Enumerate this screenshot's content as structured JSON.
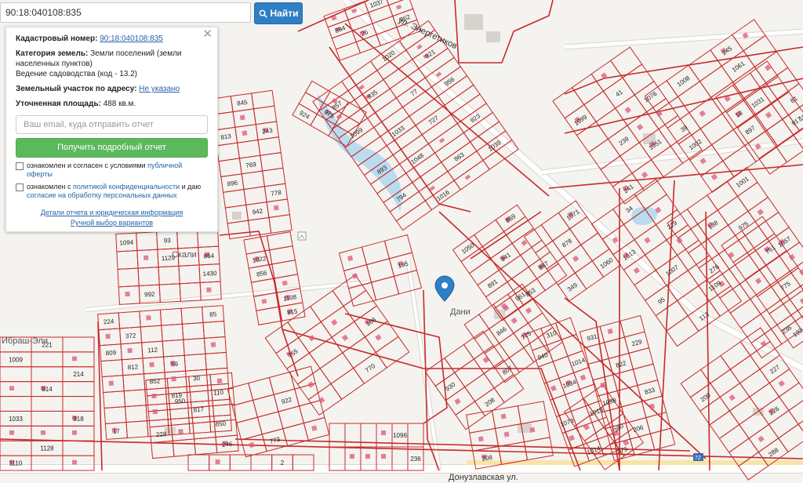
{
  "search": {
    "value": "90:18:040108:835",
    "button_label": "Найти"
  },
  "panel": {
    "cadastral_label": "Кадастровый номер:",
    "cadastral_value": "90:18:040108:835",
    "category_label": "Категория земель:",
    "category_value": "Земли поселений (земли населенных пунктов)",
    "usage_value": "Ведение садоводства (код - 13.2)",
    "address_label": "Земельный участок по адресу:",
    "address_value": "Не указано",
    "area_label": "Уточненная площадь:",
    "area_value": "488 кв.м.",
    "email_placeholder": "Ваш email, куда отправить отчет",
    "report_button": "Получить подробный отчет",
    "check1_text": "ознакомлен и согласен с условиями",
    "check1_link": "публичной оферты",
    "check2_text": "ознакомлен с",
    "check2_link": "политикой конфиденциальности",
    "check2_mid": "и даю",
    "check2_link2": "согласие на обработку персональных данных",
    "details_link": "Детали отчета и юридическая информация",
    "manual_link": "Ручной выбор вариантов"
  },
  "map": {
    "streets": {
      "energetikov": "ул. Энергетиков",
      "donuzlav": "Донузлавская ул.",
      "skalistaya": "Скали",
      "ibrash": "Ибраш-Эли",
      "dan": "Дани"
    },
    "marker_icon": "map-pin-icon",
    "accent_color": "#c62b2b",
    "parcel_numbers": [
      "224",
      "372",
      "112",
      "59",
      "30",
      "110",
      "17",
      "845",
      "243",
      "896",
      "942",
      "93",
      "864",
      "992",
      "1009",
      "914",
      "918",
      "1110",
      "856",
      "815",
      "924",
      "857",
      "821",
      "77",
      "1033",
      "893",
      "923",
      "863",
      "1016",
      "894",
      "862",
      "859",
      "891",
      "853",
      "846",
      "807",
      "940",
      "1034",
      "1019",
      "931",
      "822",
      "833",
      "279",
      "878",
      "1060",
      "41",
      "239",
      "241",
      "245",
      "39",
      "18",
      "81",
      "34",
      "229",
      "95",
      "113",
      "138",
      "276",
      "1057",
      "775",
      "236",
      "200",
      "227",
      "226",
      "288",
      "755",
      "166",
      "770",
      "195",
      "930",
      "208",
      "950",
      "228",
      "246",
      "922",
      "773",
      "1096",
      "236",
      "208",
      "2",
      "380",
      "1031",
      "917",
      "751",
      "192",
      "85",
      "809",
      "812",
      "852",
      "819",
      "817",
      "850",
      "813",
      "769",
      "778",
      "1094",
      "1129",
      "1430",
      "221",
      "214",
      "1033",
      "1128",
      "1022",
      "1108",
      "975",
      "1020",
      "935",
      "1099",
      "956",
      "727",
      "1048",
      "794",
      "1039",
      "1037",
      "26",
      "1050",
      "941",
      "887",
      "961",
      "775",
      "310",
      "1014",
      "1073",
      "1014",
      "229",
      "1058",
      "206",
      "1071",
      "349",
      "1099",
      "1076",
      "1051",
      "1008",
      "1061",
      "1002",
      "897",
      "1088",
      "1013",
      "1007",
      "1109",
      "1001",
      "975"
    ]
  }
}
